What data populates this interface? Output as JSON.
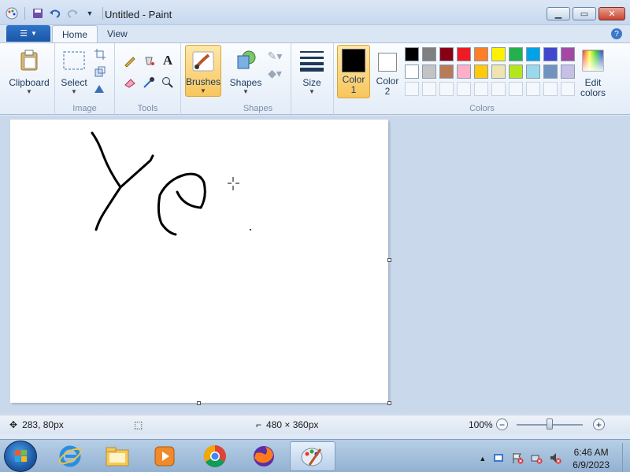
{
  "window": {
    "title": "Untitled - Paint",
    "minimize_icon": "minimize-icon",
    "maximize_icon": "maximize-icon",
    "close_icon": "close-icon"
  },
  "quick_access": [
    "paint-app-icon",
    "save-icon",
    "undo-icon",
    "redo-icon",
    "customize-dropdown-icon"
  ],
  "ribbon": {
    "tabs": [
      {
        "label": "Home",
        "active": true
      },
      {
        "label": "View",
        "active": false
      }
    ],
    "groups": {
      "clipboard": {
        "label": "Clipboard"
      },
      "image": {
        "label": "Image",
        "select_label": "Select"
      },
      "tools": {
        "label": "Tools"
      },
      "brushes": {
        "label": "Brushes"
      },
      "shapes": {
        "label": "Shapes",
        "shapes_label": "Shapes"
      },
      "size": {
        "label": "Size"
      },
      "colors": {
        "label": "Colors",
        "color1_label": "Color\n1",
        "color2_label": "Color\n2",
        "edit_colors_label": "Edit\ncolors",
        "color1": "#000000",
        "color2": "#ffffff",
        "palette_row1": [
          "#000000",
          "#7f7f7f",
          "#880015",
          "#ed1c24",
          "#ff7f27",
          "#fff200",
          "#22b14c",
          "#00a2e8",
          "#3f48cc",
          "#a349a4"
        ],
        "palette_row2": [
          "#ffffff",
          "#c3c3c3",
          "#b97a57",
          "#ffaec9",
          "#ffc90e",
          "#efe4b0",
          "#b5e61d",
          "#99d9ea",
          "#7092be",
          "#c8bfe7"
        ]
      }
    }
  },
  "statusbar": {
    "cursor_position": "283, 80px",
    "selection_size": "",
    "canvas_size": "480 × 360px",
    "zoom": "100%",
    "zoom_fraction": 0.5
  },
  "taskbar": {
    "apps": [
      "internet-explorer-icon",
      "file-explorer-icon",
      "media-player-icon",
      "chrome-icon",
      "firefox-icon",
      "paint-icon"
    ],
    "time": "6:46 AM",
    "date": "6/9/2023"
  }
}
